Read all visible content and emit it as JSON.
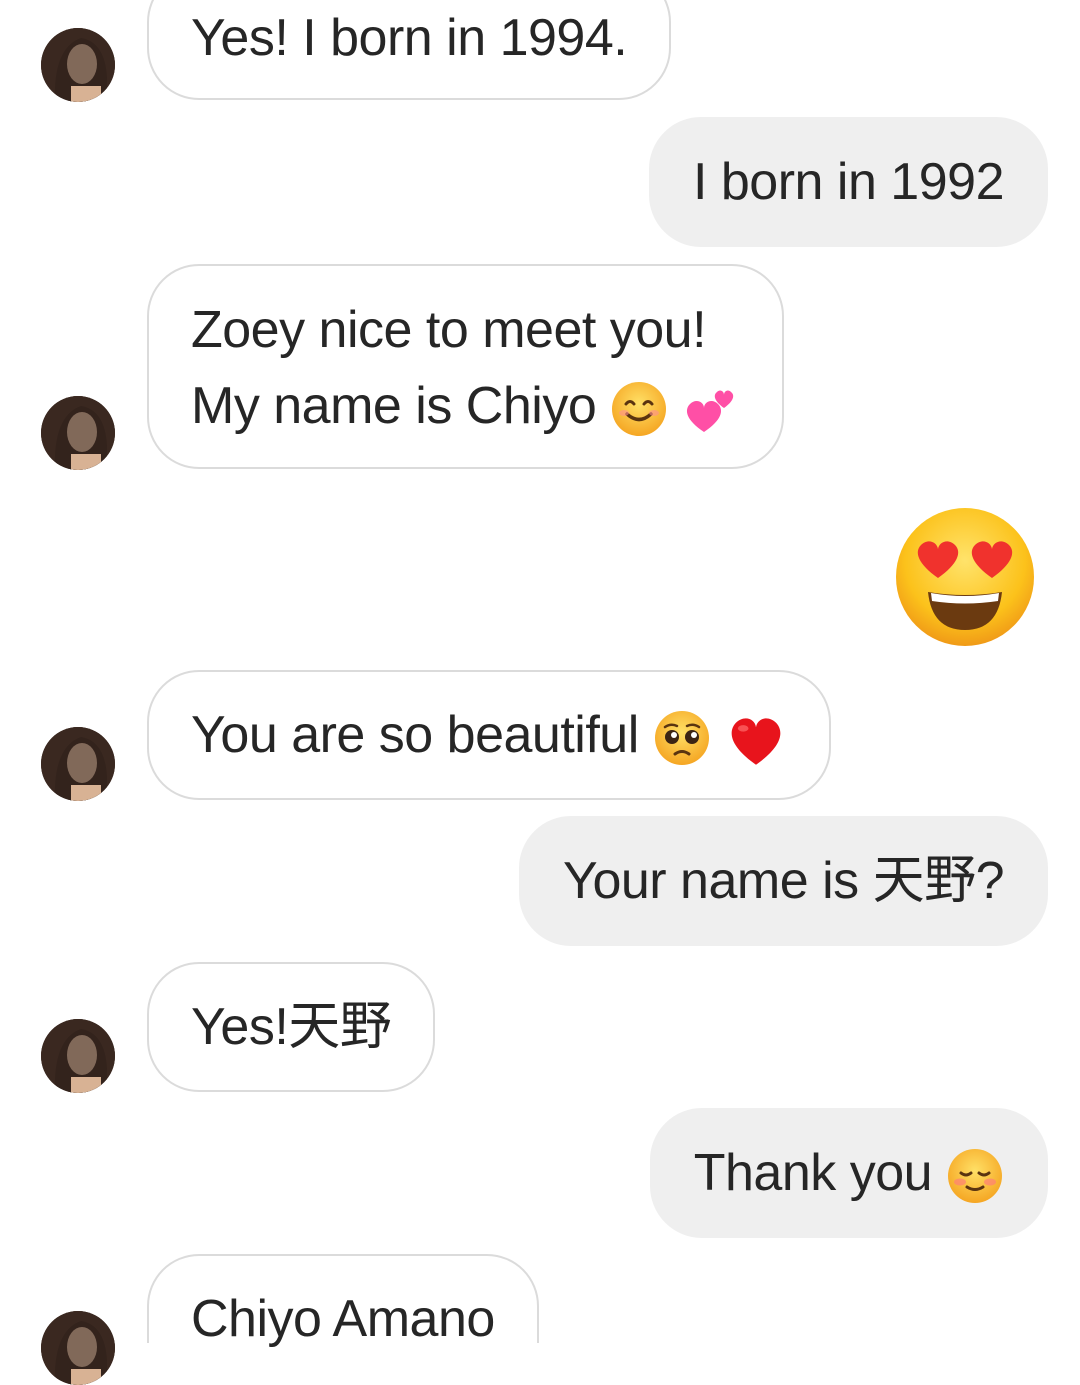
{
  "messages": [
    {
      "side": "incoming",
      "text": "Yes! I born in 1994."
    },
    {
      "side": "outgoing",
      "text": "I born in 1992"
    },
    {
      "side": "incoming",
      "lines": [
        "Zoey nice to meet you!",
        "My name is Chiyo"
      ],
      "emoji": [
        "smiling-face-icon",
        "two-hearts-icon"
      ]
    },
    {
      "side": "outgoing",
      "emoji": [
        "heart-eyes-icon"
      ]
    },
    {
      "side": "incoming",
      "text": "You are so beautiful",
      "emoji": [
        "pleading-face-icon",
        "red-heart-icon"
      ]
    },
    {
      "side": "outgoing",
      "text": "Your name is 天野?"
    },
    {
      "side": "incoming",
      "text": "Yes!天野"
    },
    {
      "side": "outgoing",
      "text": "Thank you",
      "emoji": [
        "smiling-blush-icon"
      ]
    },
    {
      "side": "incoming",
      "text": "Chiyo Amano"
    }
  ],
  "colors": {
    "incoming_bg": "#ffffff",
    "incoming_border": "#dbdbdb",
    "outgoing_bg": "#efefef",
    "text": "#262626"
  }
}
